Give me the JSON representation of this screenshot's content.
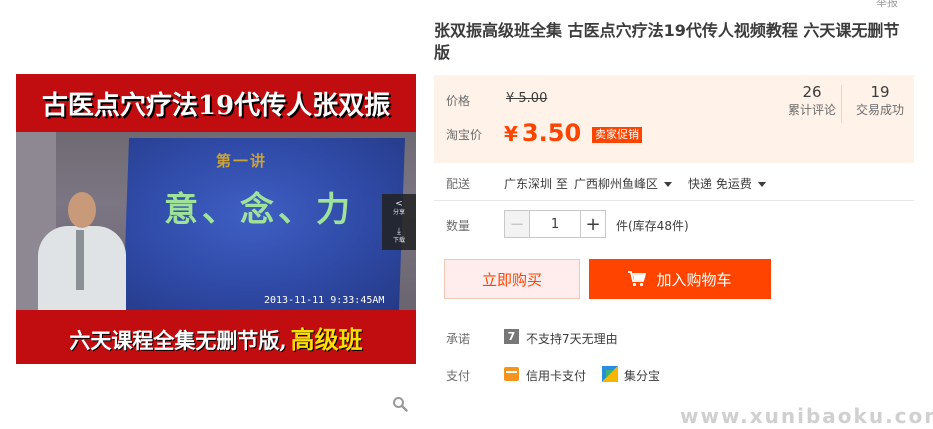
{
  "report_link": "举报",
  "main_image": {
    "top_text": "古医点穴疗法19代传人张双振",
    "screen_sub": "第一讲",
    "screen_main": "意、念、力",
    "timestamp": "2013-11-11   9:33:45AM",
    "bottom_text": "六天课程全集无删节版,",
    "bottom_highlight": "高级班",
    "share_label": "分享",
    "download_label": "下载"
  },
  "product": {
    "title": "张双振高级班全集 古医点穴疗法19代传人视频教程 六天课无删节版"
  },
  "price": {
    "original_label": "价格",
    "original_value": "¥ 5.00",
    "promo_label": "淘宝价",
    "promo_currency": "¥",
    "promo_value": "3.50",
    "promo_badge": "卖家促销",
    "reviews_count": "26",
    "reviews_label": "累计评论",
    "sales_count": "19",
    "sales_label": "交易成功"
  },
  "shipping": {
    "label": "配送",
    "from": "广东深圳 至",
    "to": "广西柳州鱼峰区",
    "fee": "快递 免运费"
  },
  "quantity": {
    "label": "数量",
    "minus": "−",
    "value": "1",
    "plus": "+",
    "stock": "件(库存48件)"
  },
  "actions": {
    "buy_now": "立即购买",
    "add_cart": "加入购物车"
  },
  "promise": {
    "label": "承诺",
    "badge": "7",
    "text": "不支持7天无理由"
  },
  "payment": {
    "label": "支付",
    "method1": "信用卡支付",
    "method2": "集分宝"
  },
  "watermark": "www.xunibaoku.com",
  "colors": {
    "accent": "#ff4400",
    "price_panel_bg": "#fff2e8",
    "image_band": "#c20d10"
  }
}
